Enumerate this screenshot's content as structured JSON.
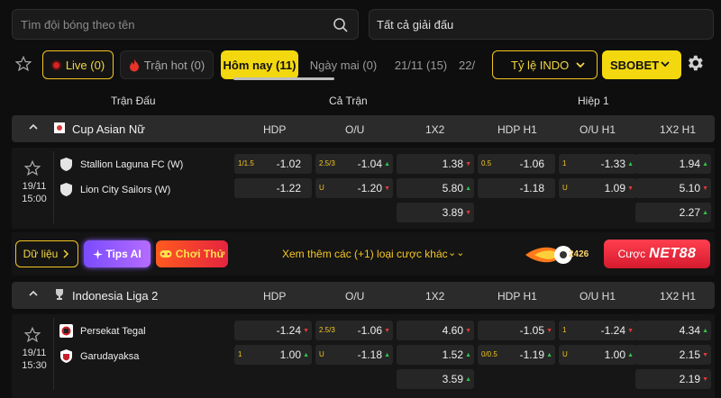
{
  "search": {
    "placeholder": "Tìm đội bóng theo tên"
  },
  "league_filter": {
    "label": "Tất cả giải đấu"
  },
  "tabs": {
    "live": "Live (0)",
    "hot": "Trận hot (0)",
    "today": "Hôm nay (11)",
    "tomorrow": "Ngày mai (0)",
    "d2111": "21/11 (15)",
    "d22": "22/"
  },
  "odds_type": "Tỷ lệ INDO",
  "bookmaker": "SBOBET",
  "columns": {
    "match": "Trận Đấu",
    "full": "Cả Trận",
    "half": "Hiệp 1"
  },
  "market_headers": [
    "HDP",
    "O/U",
    "1X2",
    "HDP H1",
    "O/U H1",
    "1X2 H1"
  ],
  "leagues": [
    {
      "name": "Cup Asian Nữ",
      "match": {
        "date": "19/11",
        "time": "15:00",
        "home": "Stallion Laguna FC (W)",
        "away": "Lion City Sailors (W)",
        "hdp": {
          "line": "1/1.5",
          "home": "-1.02",
          "away": "-1.22"
        },
        "ou": {
          "line_over": "2.5/3",
          "line_under": "U",
          "over": "-1.04",
          "under": "-1.20"
        },
        "x12": {
          "home": "1.38",
          "away": "5.80",
          "draw": "3.89"
        },
        "hdp_h1": {
          "line": "0.5",
          "home": "-1.06",
          "away": "-1.18"
        },
        "ou_h1": {
          "line_over": "1",
          "line_under": "U",
          "over": "-1.33",
          "under": "1.09"
        },
        "x12_h1": {
          "home": "1.94",
          "away": "5.10",
          "draw": "2.27"
        }
      }
    },
    {
      "name": "Indonesia Liga 2",
      "match": {
        "date": "19/11",
        "time": "15:30",
        "home": "Persekat Tegal",
        "away": "Garudayaksa",
        "hdp": {
          "line": "1",
          "home": "-1.24",
          "away": "1.00"
        },
        "ou": {
          "line_over": "2.5/3",
          "line_under": "U",
          "over": "-1.06",
          "under": "-1.18"
        },
        "x12": {
          "home": "4.60",
          "away": "1.52",
          "draw": "3.59"
        },
        "hdp_h1": {
          "line": "0/0.5",
          "home": "-1.05",
          "away": "-1.19"
        },
        "ou_h1": {
          "line_over": "1",
          "line_under": "U",
          "over": "-1.24",
          "under": "1.00"
        },
        "x12_h1": {
          "home": "4.34",
          "away": "2.15",
          "draw": "2.19"
        }
      }
    }
  ],
  "actions": {
    "data": "Dữ liệu",
    "tips": "Tips AI",
    "play": "Chơi Thử",
    "more": "Xem thêm các (+1) loại cược khác",
    "promo_num": "2426",
    "bet_label": "Cược",
    "bet_brand": "NET88"
  },
  "colors": {
    "accent": "#f3d80f",
    "up": "#35c24b",
    "down": "#e23b3b",
    "live": "#d52525"
  }
}
